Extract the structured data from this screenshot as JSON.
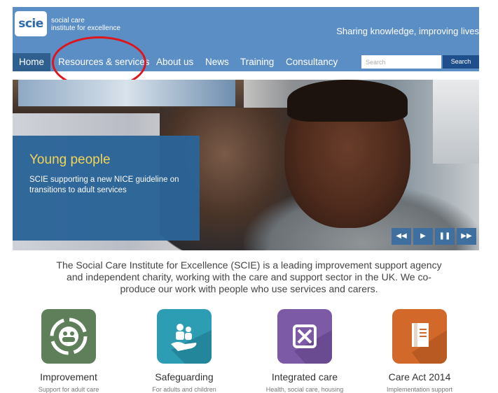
{
  "header": {
    "logo": "scie",
    "logo_text_line1": "social care",
    "logo_text_line2": "institute for excellence",
    "tagline": "Sharing knowledge, improving lives",
    "colors": {
      "header_bg": "#5b8ec4",
      "active_nav": "#2f5f8f",
      "search_button": "#1f4f8a"
    }
  },
  "nav": {
    "items": [
      {
        "label": "Home"
      },
      {
        "label": "Resources & services"
      },
      {
        "label": "About us"
      },
      {
        "label": "News"
      },
      {
        "label": "Training"
      },
      {
        "label": "Consultancy"
      }
    ],
    "active": "Home"
  },
  "search": {
    "placeholder": "Search",
    "button_label": "Search"
  },
  "hero": {
    "title": "Young people",
    "description": "SCIE supporting a new NICE guideline on transitions to adult services",
    "controls": {
      "rewind": "◀◀",
      "play": "▶",
      "pause": "❚❚",
      "forward": "▶▶"
    }
  },
  "intro": "The Social Care Institute for Excellence (SCIE) is a leading improvement support agency and independent charity, working with the care and support sector in the UK. We co-produce our work with people who use services and carers.",
  "tiles": [
    {
      "label": "Improvement",
      "subtitle": "Support for adult care",
      "color": "#5f7f5b"
    },
    {
      "label": "Safeguarding",
      "subtitle": "For adults and children",
      "color": "#2d9db3"
    },
    {
      "label": "Integrated care",
      "subtitle": "Health, social care, housing",
      "color": "#7d5aa6"
    },
    {
      "label": "Care Act 2014",
      "subtitle": "Implementation support",
      "color": "#d2692a"
    }
  ]
}
